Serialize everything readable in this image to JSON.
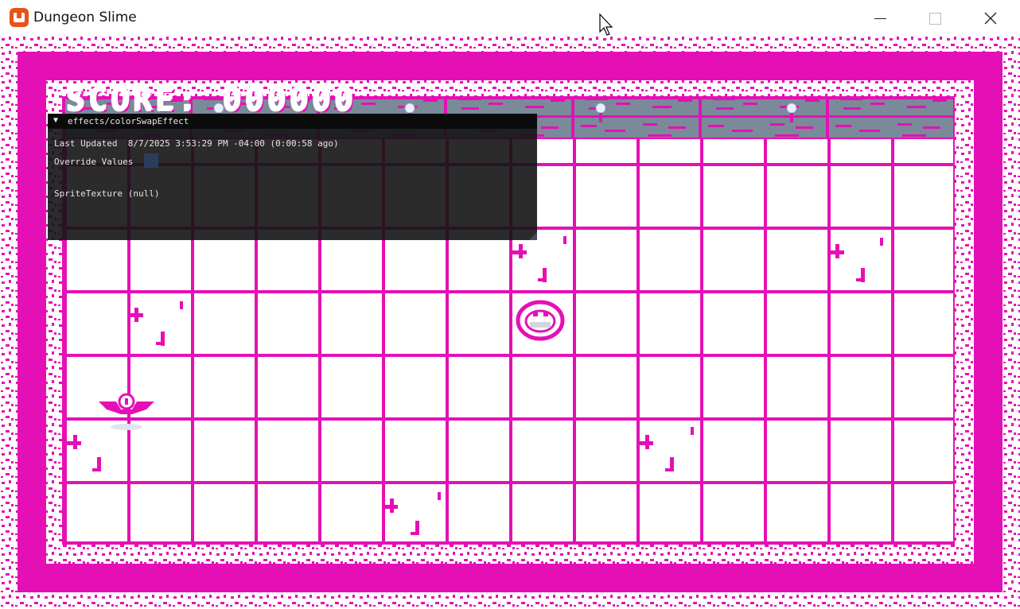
{
  "window": {
    "title": "Dungeon Slime",
    "icon": "monogame-icon"
  },
  "hud": {
    "score_text": "SCORE: 000000"
  },
  "debug_panel": {
    "title": "effects/colorSwapEffect",
    "last_updated_label": "Last Updated",
    "last_updated_value": "8/7/2025 3:53:29 PM -04:00 (0:00:58 ago)",
    "override_label": "Override Values",
    "override_checked": false,
    "sprite_texture_label": "SpriteTexture",
    "sprite_texture_value": "(null)"
  },
  "colors": {
    "wall": "#e510b5",
    "floor": "#ffffff",
    "top_wall": "#7a8a99",
    "panel": "#141414"
  }
}
